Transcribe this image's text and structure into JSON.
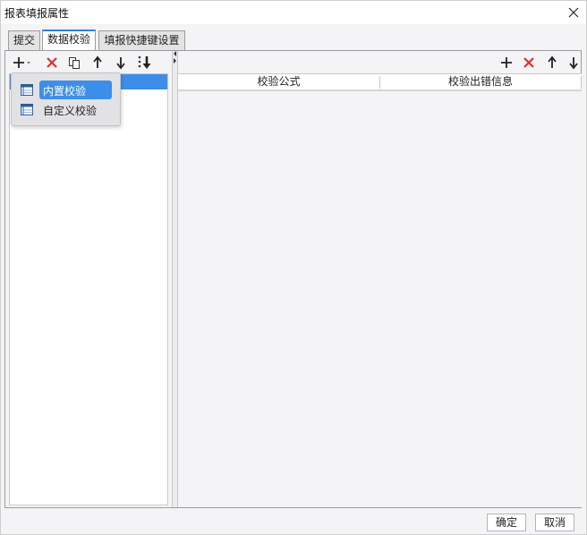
{
  "window": {
    "title": "报表填报属性"
  },
  "tabs": [
    {
      "label": "提交"
    },
    {
      "label": "数据校验"
    },
    {
      "label": "填报快捷键设置"
    }
  ],
  "left_toolbar": {
    "icons": [
      "add-icon",
      "dropdown-caret-icon",
      "delete-icon",
      "copy-icon",
      "move-up-icon",
      "move-down-icon",
      "sort-icon"
    ]
  },
  "add_menu": {
    "items": [
      {
        "label": "内置校验",
        "icon": "table-icon",
        "highlighted": true
      },
      {
        "label": "自定义校验",
        "icon": "table-icon",
        "highlighted": false
      }
    ]
  },
  "right_toolbar": {
    "icons": [
      "add-icon",
      "delete-icon",
      "move-up-icon",
      "move-down-icon"
    ]
  },
  "table": {
    "columns": [
      "校验公式",
      "校验出错信息"
    ],
    "rows": []
  },
  "footer": {
    "ok_label": "确定",
    "cancel_label": "取消"
  },
  "colors": {
    "accent": "#3d8ee8",
    "delete": "#e03030",
    "tab_active_border": "#2f80d8"
  }
}
